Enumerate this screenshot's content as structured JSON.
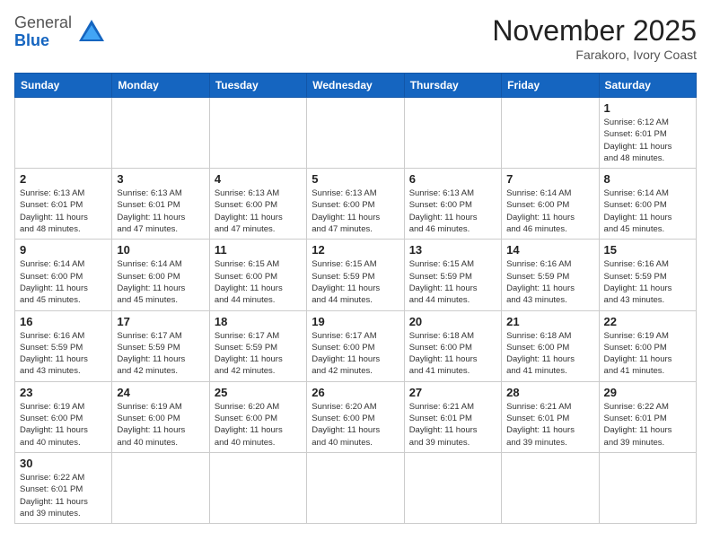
{
  "header": {
    "logo_general": "General",
    "logo_blue": "Blue",
    "month_title": "November 2025",
    "subtitle": "Farakoro, Ivory Coast"
  },
  "days_of_week": [
    "Sunday",
    "Monday",
    "Tuesday",
    "Wednesday",
    "Thursday",
    "Friday",
    "Saturday"
  ],
  "weeks": [
    [
      {
        "day": "",
        "info": ""
      },
      {
        "day": "",
        "info": ""
      },
      {
        "day": "",
        "info": ""
      },
      {
        "day": "",
        "info": ""
      },
      {
        "day": "",
        "info": ""
      },
      {
        "day": "",
        "info": ""
      },
      {
        "day": "1",
        "info": "Sunrise: 6:12 AM\nSunset: 6:01 PM\nDaylight: 11 hours\nand 48 minutes."
      }
    ],
    [
      {
        "day": "2",
        "info": "Sunrise: 6:13 AM\nSunset: 6:01 PM\nDaylight: 11 hours\nand 48 minutes."
      },
      {
        "day": "3",
        "info": "Sunrise: 6:13 AM\nSunset: 6:01 PM\nDaylight: 11 hours\nand 47 minutes."
      },
      {
        "day": "4",
        "info": "Sunrise: 6:13 AM\nSunset: 6:00 PM\nDaylight: 11 hours\nand 47 minutes."
      },
      {
        "day": "5",
        "info": "Sunrise: 6:13 AM\nSunset: 6:00 PM\nDaylight: 11 hours\nand 47 minutes."
      },
      {
        "day": "6",
        "info": "Sunrise: 6:13 AM\nSunset: 6:00 PM\nDaylight: 11 hours\nand 46 minutes."
      },
      {
        "day": "7",
        "info": "Sunrise: 6:14 AM\nSunset: 6:00 PM\nDaylight: 11 hours\nand 46 minutes."
      },
      {
        "day": "8",
        "info": "Sunrise: 6:14 AM\nSunset: 6:00 PM\nDaylight: 11 hours\nand 45 minutes."
      }
    ],
    [
      {
        "day": "9",
        "info": "Sunrise: 6:14 AM\nSunset: 6:00 PM\nDaylight: 11 hours\nand 45 minutes."
      },
      {
        "day": "10",
        "info": "Sunrise: 6:14 AM\nSunset: 6:00 PM\nDaylight: 11 hours\nand 45 minutes."
      },
      {
        "day": "11",
        "info": "Sunrise: 6:15 AM\nSunset: 6:00 PM\nDaylight: 11 hours\nand 44 minutes."
      },
      {
        "day": "12",
        "info": "Sunrise: 6:15 AM\nSunset: 5:59 PM\nDaylight: 11 hours\nand 44 minutes."
      },
      {
        "day": "13",
        "info": "Sunrise: 6:15 AM\nSunset: 5:59 PM\nDaylight: 11 hours\nand 44 minutes."
      },
      {
        "day": "14",
        "info": "Sunrise: 6:16 AM\nSunset: 5:59 PM\nDaylight: 11 hours\nand 43 minutes."
      },
      {
        "day": "15",
        "info": "Sunrise: 6:16 AM\nSunset: 5:59 PM\nDaylight: 11 hours\nand 43 minutes."
      }
    ],
    [
      {
        "day": "16",
        "info": "Sunrise: 6:16 AM\nSunset: 5:59 PM\nDaylight: 11 hours\nand 43 minutes."
      },
      {
        "day": "17",
        "info": "Sunrise: 6:17 AM\nSunset: 5:59 PM\nDaylight: 11 hours\nand 42 minutes."
      },
      {
        "day": "18",
        "info": "Sunrise: 6:17 AM\nSunset: 5:59 PM\nDaylight: 11 hours\nand 42 minutes."
      },
      {
        "day": "19",
        "info": "Sunrise: 6:17 AM\nSunset: 6:00 PM\nDaylight: 11 hours\nand 42 minutes."
      },
      {
        "day": "20",
        "info": "Sunrise: 6:18 AM\nSunset: 6:00 PM\nDaylight: 11 hours\nand 41 minutes."
      },
      {
        "day": "21",
        "info": "Sunrise: 6:18 AM\nSunset: 6:00 PM\nDaylight: 11 hours\nand 41 minutes."
      },
      {
        "day": "22",
        "info": "Sunrise: 6:19 AM\nSunset: 6:00 PM\nDaylight: 11 hours\nand 41 minutes."
      }
    ],
    [
      {
        "day": "23",
        "info": "Sunrise: 6:19 AM\nSunset: 6:00 PM\nDaylight: 11 hours\nand 40 minutes."
      },
      {
        "day": "24",
        "info": "Sunrise: 6:19 AM\nSunset: 6:00 PM\nDaylight: 11 hours\nand 40 minutes."
      },
      {
        "day": "25",
        "info": "Sunrise: 6:20 AM\nSunset: 6:00 PM\nDaylight: 11 hours\nand 40 minutes."
      },
      {
        "day": "26",
        "info": "Sunrise: 6:20 AM\nSunset: 6:00 PM\nDaylight: 11 hours\nand 40 minutes."
      },
      {
        "day": "27",
        "info": "Sunrise: 6:21 AM\nSunset: 6:01 PM\nDaylight: 11 hours\nand 39 minutes."
      },
      {
        "day": "28",
        "info": "Sunrise: 6:21 AM\nSunset: 6:01 PM\nDaylight: 11 hours\nand 39 minutes."
      },
      {
        "day": "29",
        "info": "Sunrise: 6:22 AM\nSunset: 6:01 PM\nDaylight: 11 hours\nand 39 minutes."
      }
    ],
    [
      {
        "day": "30",
        "info": "Sunrise: 6:22 AM\nSunset: 6:01 PM\nDaylight: 11 hours\nand 39 minutes."
      },
      {
        "day": "",
        "info": ""
      },
      {
        "day": "",
        "info": ""
      },
      {
        "day": "",
        "info": ""
      },
      {
        "day": "",
        "info": ""
      },
      {
        "day": "",
        "info": ""
      },
      {
        "day": "",
        "info": ""
      }
    ]
  ]
}
